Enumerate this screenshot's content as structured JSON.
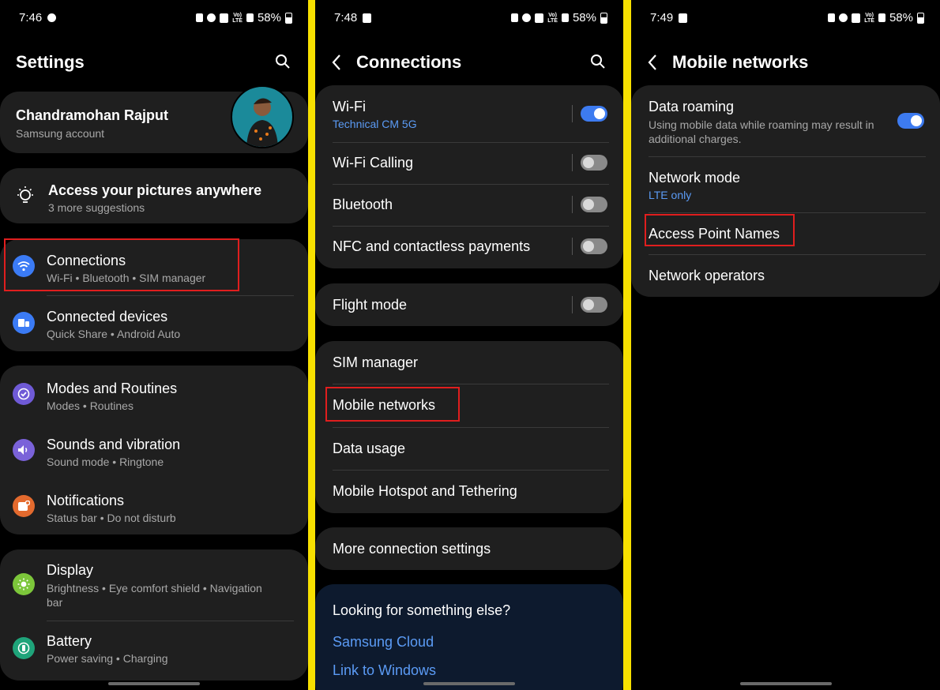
{
  "screen1": {
    "status": {
      "time": "7:46",
      "battery": "58%"
    },
    "title": "Settings",
    "account": {
      "name": "Chandramohan Rajput",
      "subtitle": "Samsung account"
    },
    "suggestion": {
      "title": "Access your pictures anywhere",
      "subtitle": "3 more suggestions"
    },
    "items": [
      {
        "label": "Connections",
        "sub": "Wi-Fi  •  Bluetooth  •  SIM manager",
        "icon": "wifi-icon",
        "color": "#3b7bf5"
      },
      {
        "label": "Connected devices",
        "sub": "Quick Share  •  Android Auto",
        "icon": "devices-icon",
        "color": "#3b7bf5"
      },
      {
        "label": "Modes and Routines",
        "sub": "Modes  •  Routines",
        "icon": "check-circle-icon",
        "color": "#6f5ad6"
      },
      {
        "label": "Sounds and vibration",
        "sub": "Sound mode  •  Ringtone",
        "icon": "speaker-icon",
        "color": "#7a62d9"
      },
      {
        "label": "Notifications",
        "sub": "Status bar  •  Do not disturb",
        "icon": "notification-icon",
        "color": "#e36a2e"
      },
      {
        "label": "Display",
        "sub1": "Brightness  •  Eye comfort shield  •  Navigation",
        "sub2": "bar",
        "icon": "sun-icon",
        "color": "#7cc63a"
      },
      {
        "label": "Battery",
        "sub": "Power saving  •  Charging",
        "icon": "battery-icon",
        "color": "#1fa47a"
      }
    ]
  },
  "screen2": {
    "status": {
      "time": "7:48",
      "battery": "58%"
    },
    "title": "Connections",
    "wifi": {
      "label": "Wi-Fi",
      "network": "Technical CM 5G"
    },
    "wifi_calling": "Wi-Fi Calling",
    "bluetooth": "Bluetooth",
    "nfc": "NFC and contactless payments",
    "flight_mode": "Flight mode",
    "sim_manager": "SIM manager",
    "mobile_networks": "Mobile networks",
    "data_usage": "Data usage",
    "hotspot": "Mobile Hotspot and Tethering",
    "more": "More connection settings",
    "looking": {
      "title": "Looking for something else?",
      "link1": "Samsung Cloud",
      "link2": "Link to Windows"
    }
  },
  "screen3": {
    "status": {
      "time": "7:49",
      "battery": "58%"
    },
    "title": "Mobile networks",
    "data_roaming": {
      "label": "Data roaming",
      "sub1": "Using mobile data while roaming may result in",
      "sub2": "additional charges."
    },
    "network_mode": {
      "label": "Network mode",
      "value": "LTE only"
    },
    "apn": "Access Point Names",
    "operators": "Network operators"
  },
  "colors": {
    "accent": "#3d7bf0",
    "highlight": "#e01e1e",
    "divider": "#f7e000",
    "link": "#5b9bf5"
  }
}
